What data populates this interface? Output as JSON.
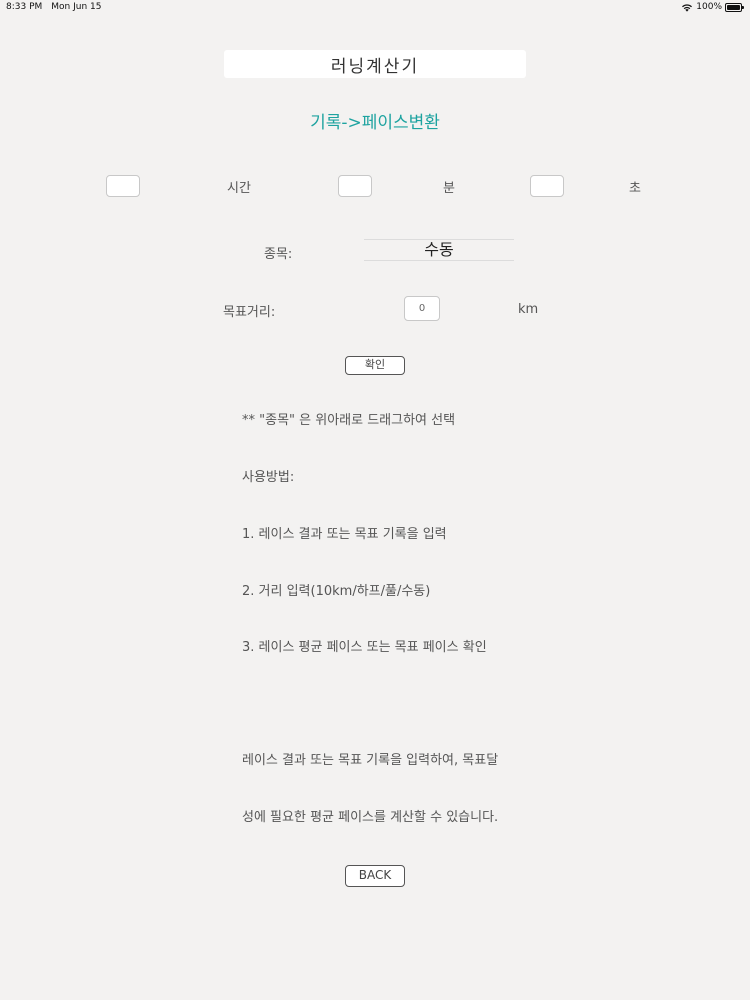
{
  "status_bar": {
    "time": "8:33 PM",
    "date": "Mon Jun 15",
    "battery": "100%",
    "icons": [
      "wifi-icon",
      "battery-icon"
    ]
  },
  "title": "러닝계산기",
  "subtitle": "기록->페이스변환",
  "subtitle_color": "#1ea3a0",
  "time_inputs": {
    "hours": {
      "value": "",
      "label": "시간"
    },
    "minutes": {
      "value": "",
      "label": "분"
    },
    "seconds": {
      "value": "",
      "label": "초"
    }
  },
  "event": {
    "label": "종목:",
    "selected": "수동"
  },
  "distance": {
    "label": "목표거리:",
    "value": "0",
    "unit": "km"
  },
  "confirm_label": "확인",
  "instructions": [
    "** \"종목\" 은 위아래로 드래그하여 선택",
    "사용방법:",
    "1. 레이스 결과 또는 목표 기록을 입력",
    "2. 거리 입력(10km/하프/풀/수동)",
    "3. 레이스 평균 페이스 또는 목표 페이스 확인"
  ],
  "description": [
    "레이스 결과 또는 목표 기록을 입력하여, 목표달",
    "성에 필요한 평균 페이스를 계산할 수 있습니다."
  ],
  "back_label": "BACK"
}
